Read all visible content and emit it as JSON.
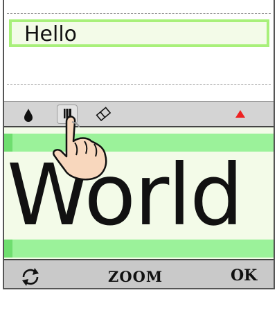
{
  "text_field": {
    "value": "Hello"
  },
  "toolbar": {
    "tools": [
      {
        "icon": "ink-drop-icon"
      },
      {
        "icon": "pen-icon",
        "selected": true
      },
      {
        "icon": "eraser-icon"
      },
      {
        "icon": "warning-triangle-icon",
        "color": "#ee2222"
      }
    ]
  },
  "canvas": {
    "handwriting": "World"
  },
  "bottom_bar": {
    "refresh_icon": "refresh-icon",
    "zoom_label": "ZOOM",
    "ok_label": "OK"
  },
  "colors": {
    "guide": "#9bf29a",
    "canvas": "#f3fbe8",
    "field_border": "#a8f07a",
    "toolbar": "#d4d4d4"
  }
}
